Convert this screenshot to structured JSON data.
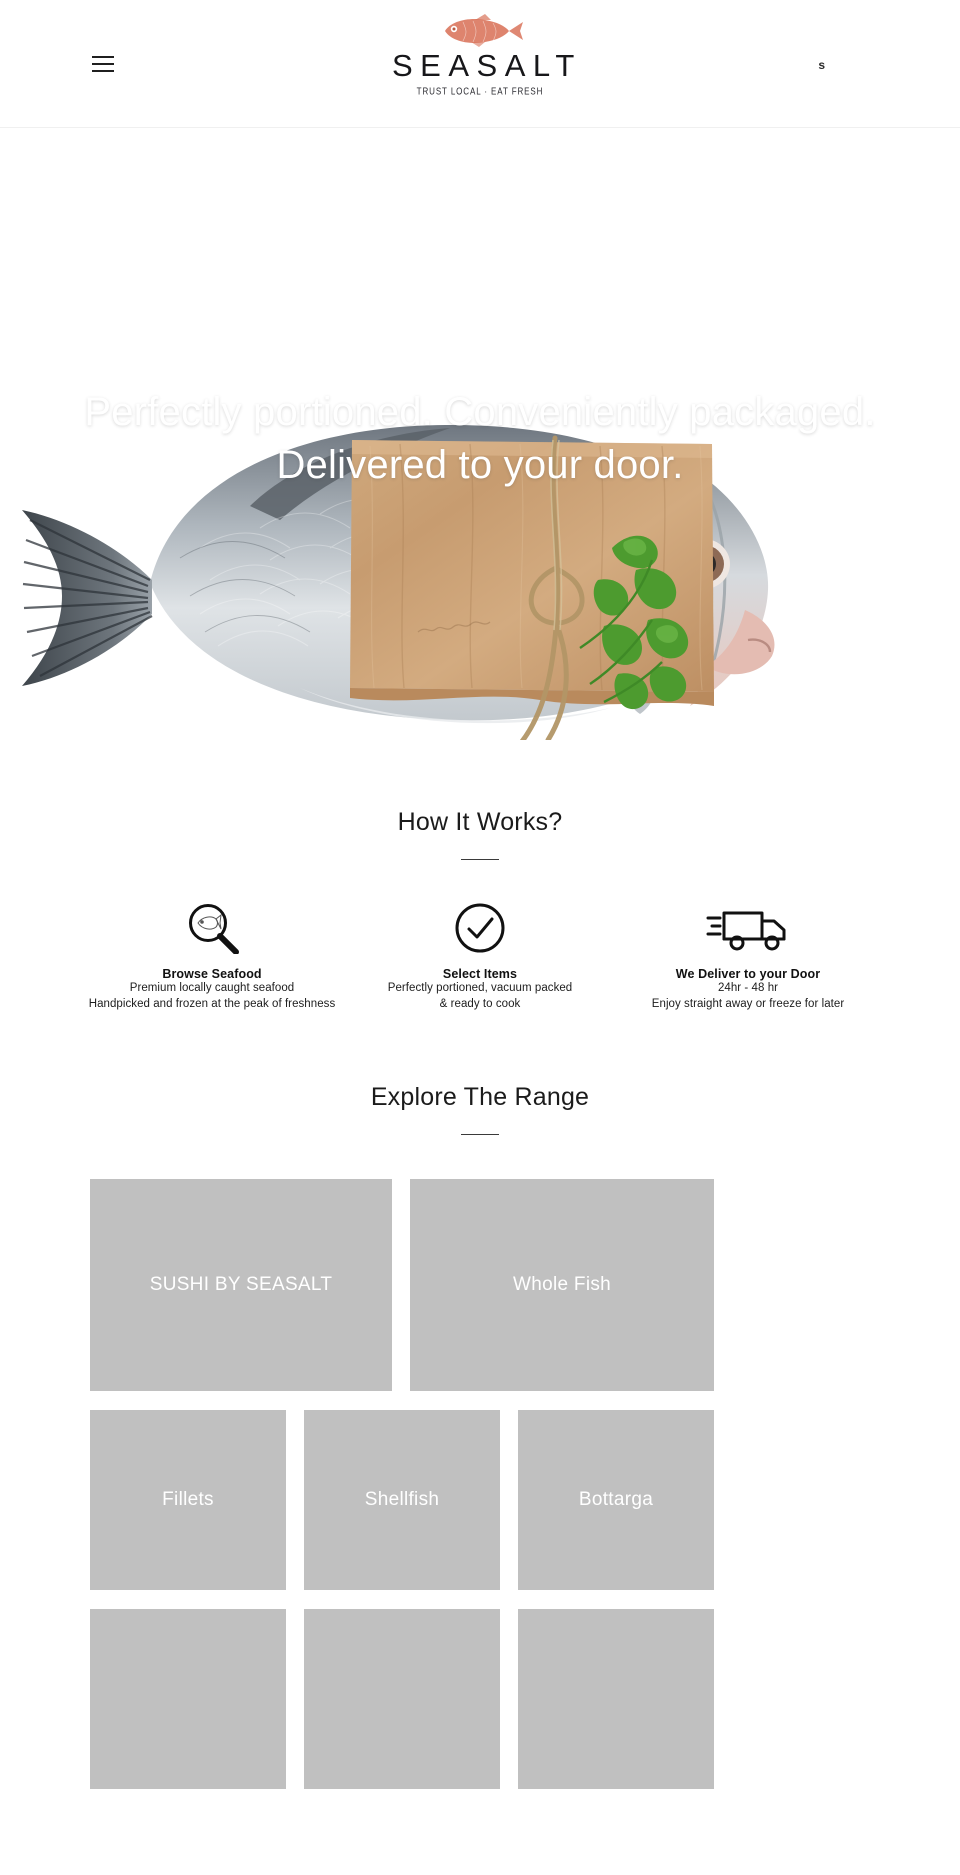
{
  "header": {
    "menu_icon": "hamburger-menu-icon",
    "logo": {
      "wordmark": "SEASALT",
      "tagline": "TRUST LOCAL · EAT FRESH",
      "fish_icon": "fish-illustration-icon",
      "fish_color": "#d9735a"
    },
    "right_label": "s"
  },
  "hero": {
    "headline": "Perfectly portioned. Conveniently packaged. Delivered to your door.",
    "image_alt": "whole-fish-wrapped-in-kraft-paper"
  },
  "how_it_works": {
    "title": "How It Works?",
    "steps": [
      {
        "icon": "magnifier-fish-icon",
        "name": "Browse Seafood",
        "line1": "Premium locally caught seafood",
        "line2": "Handpicked and frozen at the peak of freshness"
      },
      {
        "icon": "check-circle-icon",
        "name": "Select Items",
        "line1": "Perfectly portioned, vacuum packed",
        "line2": "& ready to cook"
      },
      {
        "icon": "delivery-truck-icon",
        "name": "We Deliver to your Door",
        "line1": "24hr - 48 hr",
        "line2": "Enjoy straight away or freeze for later"
      }
    ]
  },
  "explore_range": {
    "title": "Explore The Range",
    "tile_color": "#c0c0c0",
    "rows": [
      {
        "tiles": [
          {
            "label": "SUSHI BY SEASALT"
          },
          {
            "label": "Whole Fish"
          }
        ]
      },
      {
        "tiles": [
          {
            "label": "Fillets"
          },
          {
            "label": "Shellfish"
          },
          {
            "label": "Bottarga"
          }
        ]
      },
      {
        "tiles": [
          {
            "label": ""
          },
          {
            "label": ""
          },
          {
            "label": ""
          }
        ]
      }
    ]
  }
}
